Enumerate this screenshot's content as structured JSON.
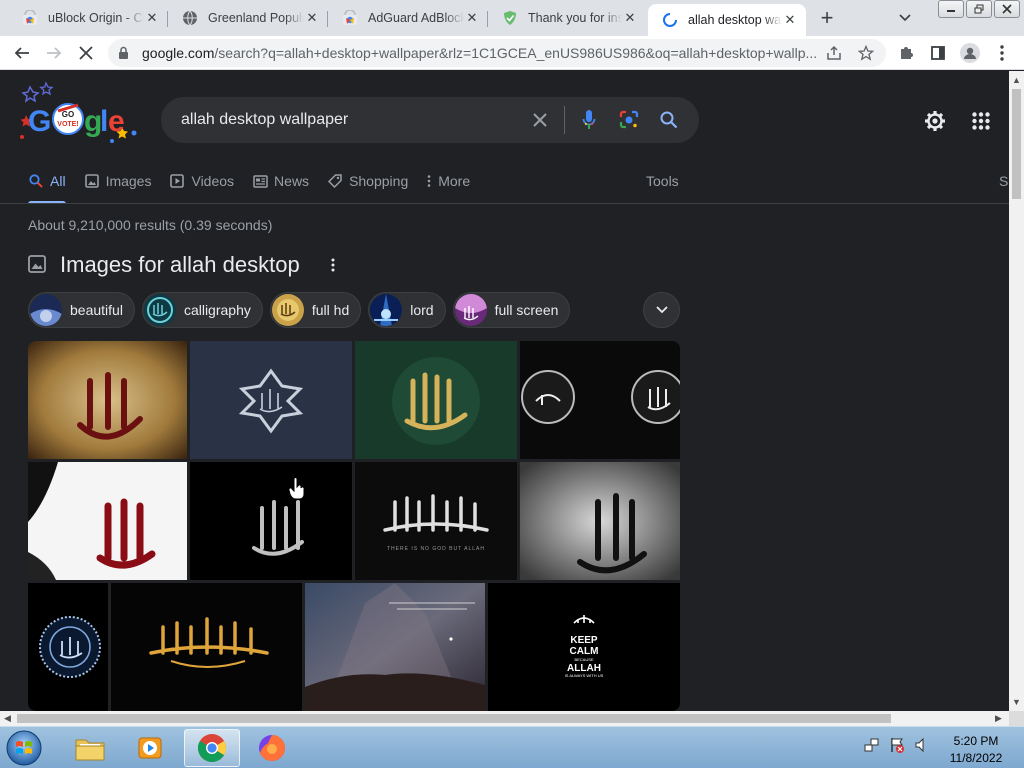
{
  "browser": {
    "tabs": [
      {
        "title": "uBlock Origin - Ch",
        "icon": "chrome-webstore-icon",
        "active": false
      },
      {
        "title": "Greenland Popula",
        "icon": "globe-icon",
        "active": false
      },
      {
        "title": "AdGuard AdBlock",
        "icon": "chrome-webstore-icon",
        "active": false
      },
      {
        "title": "Thank you for inst",
        "icon": "adguard-shield-icon",
        "active": false
      },
      {
        "title": "allah desktop wall",
        "icon": "loading-spinner-icon",
        "active": true
      }
    ],
    "new_tab_symbol": "+",
    "url_host": "google.com",
    "url_path": "/search?q=allah+desktop+wallpaper&rlz=1C1GCEA_enUS986US986&oq=allah+desktop+wallp...",
    "window_buttons": [
      "minimize",
      "restore",
      "close"
    ]
  },
  "google": {
    "query": "allah desktop wallpaper",
    "nav_tabs": [
      {
        "label": "All",
        "icon": "search-icon",
        "active": true
      },
      {
        "label": "Images",
        "icon": "image-icon",
        "active": false
      },
      {
        "label": "Videos",
        "icon": "play-icon",
        "active": false
      },
      {
        "label": "News",
        "icon": "news-icon",
        "active": false
      },
      {
        "label": "Shopping",
        "icon": "tag-icon",
        "active": false
      },
      {
        "label": "More",
        "icon": "vertical-dots-icon",
        "active": false
      }
    ],
    "tools_label": "Tools",
    "cut_off_label": "S",
    "result_stats": "About 9,210,000 results (0.39 seconds)",
    "images_heading": "Images for allah desktop",
    "chips": [
      "beautiful",
      "calligraphy",
      "full hd",
      "lord",
      "full screen"
    ],
    "logo_badge_text_1": "GO",
    "logo_badge_text_2": "VOTE!",
    "keep_calm": {
      "line1": "KEEP",
      "line2": "CALM",
      "line3": "BECAUSE",
      "line4": "ALLAH",
      "line5": "IS ALWAYS WITH US"
    },
    "tile_caption": "THERE IS NO GOD BUT ALLAH"
  },
  "taskbar": {
    "apps": [
      "windows-explorer",
      "media-player",
      "chrome",
      "firefox"
    ],
    "time": "5:20 PM",
    "date": "11/8/2022"
  },
  "colors": {
    "page_bg": "#202124",
    "link_blue": "#8ab4f8",
    "text_primary": "#e8eaed",
    "text_secondary": "#9aa0a6"
  }
}
